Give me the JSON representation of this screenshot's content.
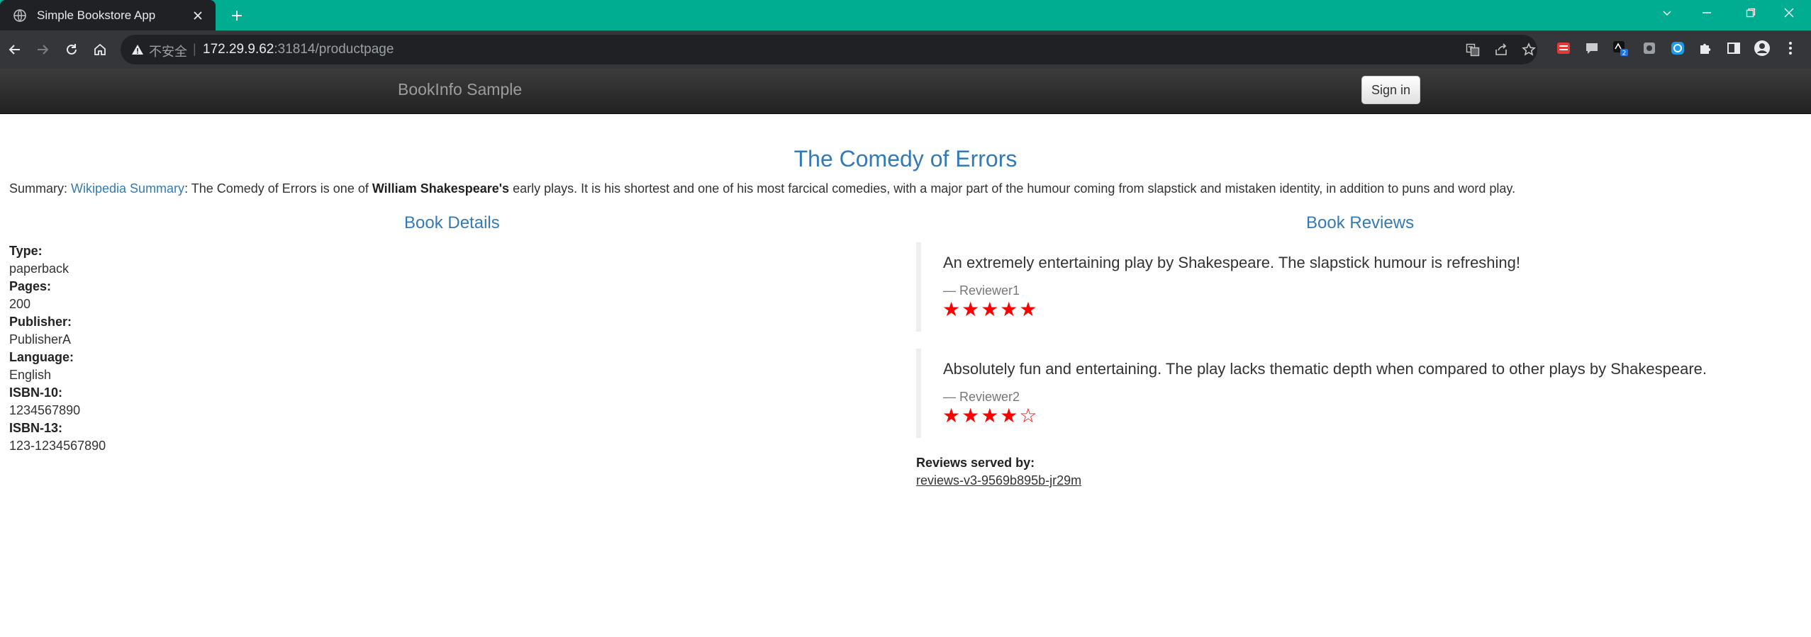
{
  "browser": {
    "tab_title": "Simple Bookstore App",
    "security_label": "不安全",
    "separator": "|",
    "url_host": "172.29.9.62",
    "url_rest": ":31814/productpage"
  },
  "navbar": {
    "brand": "BookInfo Sample",
    "signin_label": "Sign in"
  },
  "book": {
    "title": "The Comedy of Errors",
    "summary_prefix": "Summary: ",
    "summary_link": "Wikipedia Summary",
    "summary_mid": ": The Comedy of Errors is one of ",
    "summary_bold": "William Shakespeare's",
    "summary_suffix": " early plays. It is his shortest and one of his most farcical comedies, with a major part of the humour coming from slapstick and mistaken identity, in addition to puns and word play."
  },
  "details": {
    "heading": "Book Details",
    "items": [
      {
        "term": "Type:",
        "value": "paperback"
      },
      {
        "term": "Pages:",
        "value": "200"
      },
      {
        "term": "Publisher:",
        "value": "PublisherA"
      },
      {
        "term": "Language:",
        "value": "English"
      },
      {
        "term": "ISBN-10:",
        "value": "1234567890"
      },
      {
        "term": "ISBN-13:",
        "value": "123-1234567890"
      }
    ]
  },
  "reviews": {
    "heading": "Book Reviews",
    "items": [
      {
        "text": "An extremely entertaining play by Shakespeare. The slapstick humour is refreshing!",
        "author": "— Reviewer1",
        "stars": "★★★★★",
        "rating": 5
      },
      {
        "text": "Absolutely fun and entertaining. The play lacks thematic depth when compared to other plays by Shakespeare.",
        "author": "— Reviewer2",
        "stars": "★★★★☆",
        "rating": 4
      }
    ],
    "served_label": "Reviews served by:",
    "served_by": "reviews-v3-9569b895b-jr29m",
    "star_color": "#ff0000"
  },
  "colors": {
    "tab_bar": "#00ad90",
    "link": "#337ab7"
  }
}
